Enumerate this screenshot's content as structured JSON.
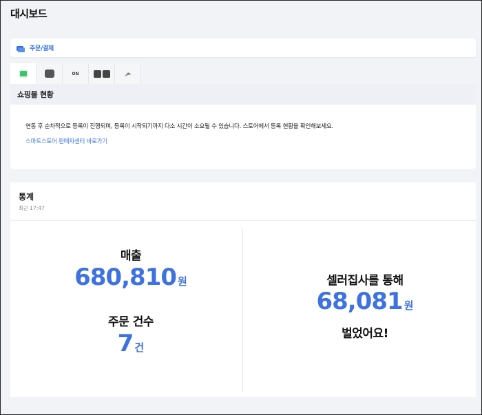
{
  "page": {
    "title": "대시보드"
  },
  "order": {
    "label": "주문/결제",
    "icon": "card-stack-icon"
  },
  "tabs": [
    {
      "icon": "naver-smartstore-icon",
      "color": "#3ec26f",
      "active": true
    },
    {
      "icon": "coupang-icon",
      "color": "#555555",
      "active": false
    },
    {
      "icon": "on-icon",
      "color": "#333333",
      "active": false
    },
    {
      "icon": "ga-icon",
      "color": "#444444",
      "active": false
    },
    {
      "icon": "bird-icon",
      "color": "#777777",
      "active": false
    }
  ],
  "shop": {
    "title": "쇼핑몰 현황",
    "description": "연동 후 순차적으로 등록이 진행되며, 등록이 시작되기까지 다소 시간이 소요될 수 있습니다. 스토어에서 등록 현황을 확인해보세요.",
    "link": "스마트스토어 판매자센터 바로가기"
  },
  "stats": {
    "title": "통계",
    "updated": "최근 17:47",
    "sales_label": "매출",
    "sales_value": "680,810",
    "sales_unit": "원",
    "count_label": "주문 건수",
    "count_value": "7",
    "count_unit": "건",
    "seller_label": "셀러집사를 통해",
    "seller_value": "68,081",
    "seller_unit": "원",
    "earn_label": "벌었어요!"
  },
  "colors": {
    "accent": "#3e72e0",
    "link": "#3b74e6"
  }
}
